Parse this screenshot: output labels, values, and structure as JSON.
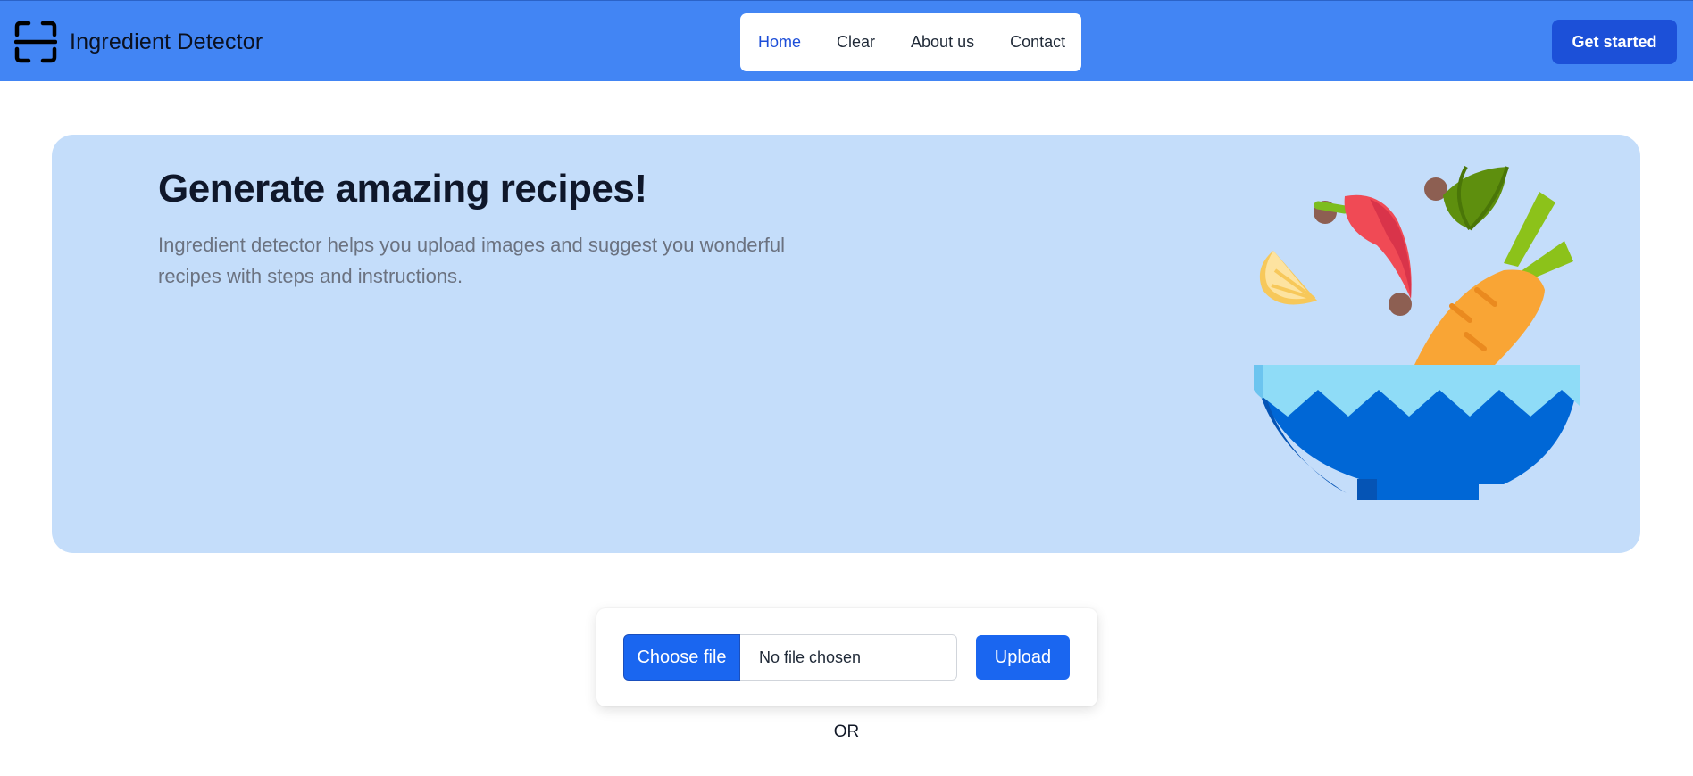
{
  "brand": {
    "name": "Ingredient Detector",
    "icon": "scan-frame-icon"
  },
  "nav": {
    "items": [
      {
        "label": "Home",
        "active": true
      },
      {
        "label": "Clear",
        "active": false
      },
      {
        "label": "About us",
        "active": false
      },
      {
        "label": "Contact",
        "active": false
      }
    ],
    "cta_label": "Get started"
  },
  "hero": {
    "title": "Generate amazing recipes!",
    "description": "Ingredient detector helps you upload images and suggest you wonderful recipes with steps and instructions.",
    "illustration": "salad-bowl-illustration"
  },
  "upload": {
    "choose_label": "Choose file",
    "file_status": "No file chosen",
    "upload_label": "Upload",
    "or_text": "OR"
  },
  "colors": {
    "navbar": "#4285f4",
    "hero_bg": "#c4ddfa",
    "primary_button": "#1a66f0",
    "cta_button": "#1c50d8"
  }
}
